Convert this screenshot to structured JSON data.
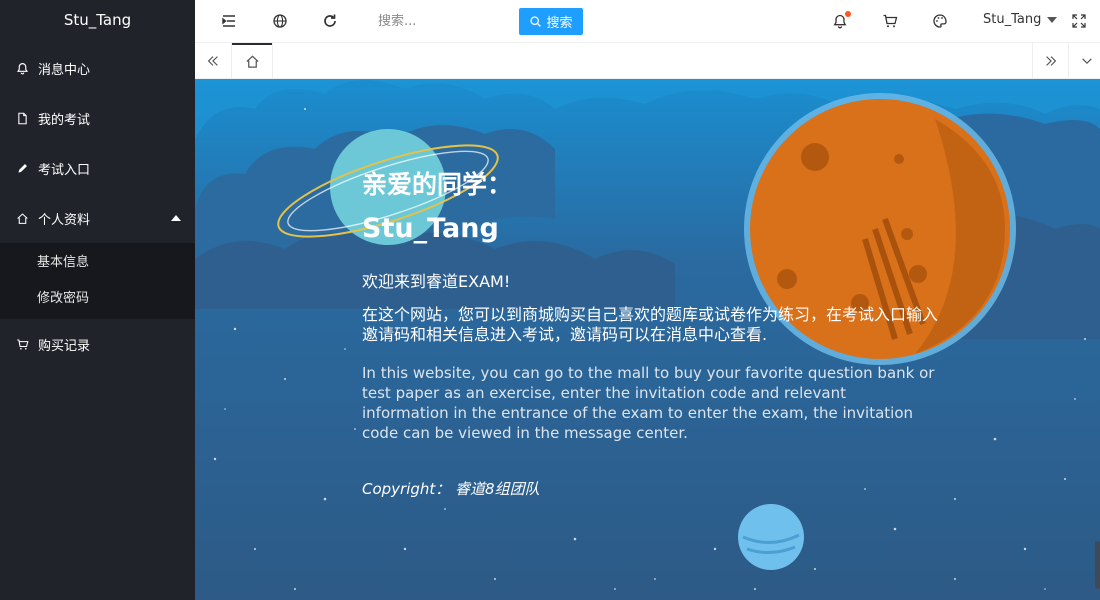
{
  "sidebar": {
    "brand": "Stu_Tang",
    "items": [
      {
        "label": "消息中心",
        "icon": "bell-icon"
      },
      {
        "label": "我的考试",
        "icon": "document-icon"
      },
      {
        "label": "考试入口",
        "icon": "pencil-icon"
      },
      {
        "label": "个人资料",
        "icon": "home-icon"
      },
      {
        "label": "购买记录",
        "icon": "cart-icon"
      }
    ],
    "profile_submenu": [
      "基本信息",
      "修改密码"
    ]
  },
  "header": {
    "search_placeholder": "搜索...",
    "search_button": "搜索",
    "username": "Stu_Tang",
    "notification_dot_color": "#ff5722",
    "accent_color": "#1e9fff"
  },
  "tabs": {
    "home_icon": "home-icon"
  },
  "main": {
    "greeting": "亲爱的同学：",
    "username": "Stu_Tang",
    "welcome": "欢迎来到睿道EXAM!",
    "description_cn": "在这个网站，您可以到商城购买自己喜欢的题库或试卷作为练习，在考试入口输入邀请码和相关信息进入考试，邀请码可以在消息中心查看.",
    "description_en": "In this website, you can go to the mall to buy your favorite question bank or test paper as an exercise, enter the invitation code and relevant information in the entrance of the exam to enter the exam, the invitation code can be viewed in the message center.",
    "copyright": "Copyright：  睿道8组团队"
  }
}
